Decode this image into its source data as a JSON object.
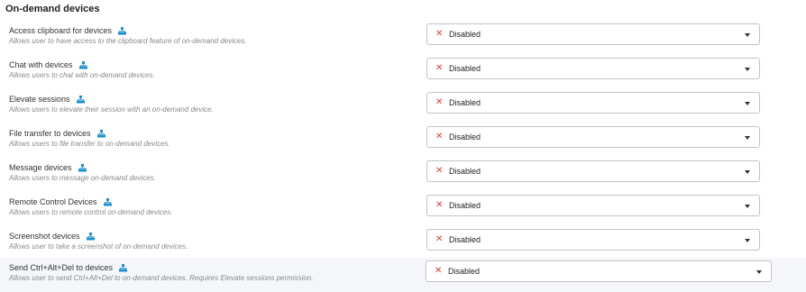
{
  "section": {
    "title": "On-demand devices"
  },
  "dropdown_value": "Disabled",
  "status_color": "#e03a3a",
  "icon_color": "#1a8fd0",
  "rows": [
    {
      "title": "Access clipboard for devices",
      "description": "Allows user to have access to the clipboard feature of on-demand devices.",
      "value": "Disabled"
    },
    {
      "title": "Chat with devices",
      "description": "Allows users to chat with on-demand devices.",
      "value": "Disabled"
    },
    {
      "title": "Elevate sessions",
      "description": "Allows users to elevate their session with an on-demand device.",
      "value": "Disabled"
    },
    {
      "title": "File transfer to devices",
      "description": "Allows users to file transfer to on-demand devices.",
      "value": "Disabled"
    },
    {
      "title": "Message devices",
      "description": "Allows users to message on-demand devices.",
      "value": "Disabled"
    },
    {
      "title": "Remote Control Devices",
      "description": "Allows users to remote control on-demand devices.",
      "value": "Disabled"
    },
    {
      "title": "Screenshot devices",
      "description": "Allows user to take a screenshot of on-demand devices.",
      "value": "Disabled"
    },
    {
      "title": "Send Ctrl+Alt+Del to devices",
      "description": "Allows user to send Ctrl+Alt+Del to on-demand devices. Requires Elevate sessions permission.",
      "value": "Disabled"
    }
  ]
}
